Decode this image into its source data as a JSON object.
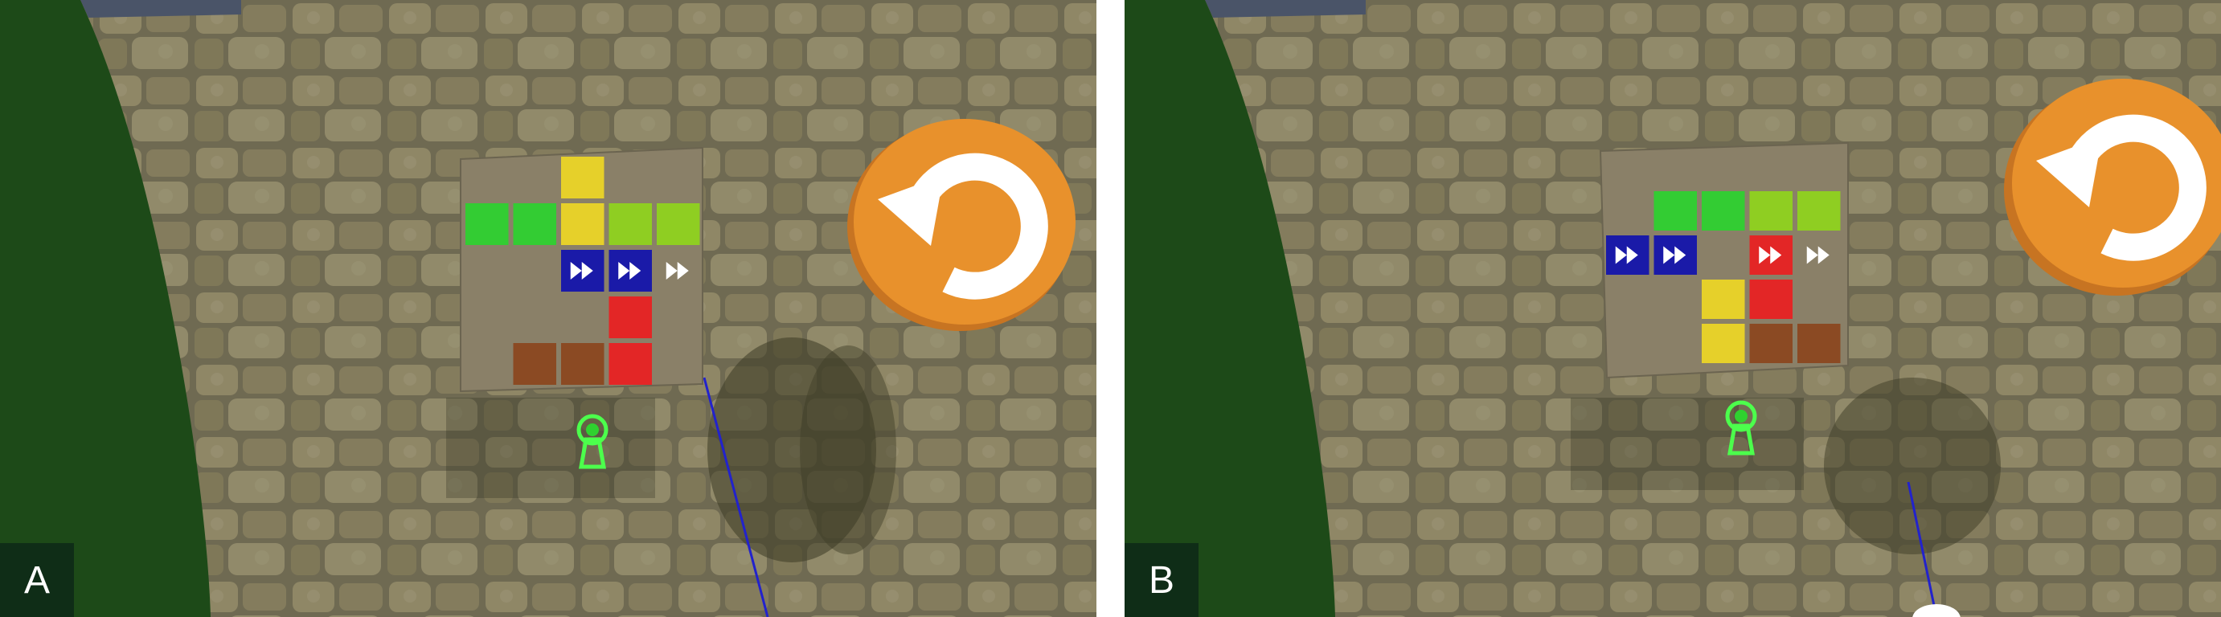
{
  "panels": [
    {
      "label": "A",
      "board": [
        [
          "empty",
          "empty",
          "yellow",
          "empty",
          "empty"
        ],
        [
          "green",
          "green",
          "yellow",
          "lime",
          "lime"
        ],
        [
          "empty",
          "empty",
          "arrow-blue",
          "arrow-blue",
          "arrow-white"
        ],
        [
          "empty",
          "empty",
          "empty",
          "red",
          "empty"
        ],
        [
          "empty",
          "brown",
          "brown",
          "red",
          "empty"
        ]
      ]
    },
    {
      "label": "B",
      "board": [
        [
          "empty",
          "empty",
          "empty",
          "empty",
          "empty"
        ],
        [
          "empty",
          "green",
          "green",
          "lime",
          "lime"
        ],
        [
          "arrow-blue",
          "arrow-blue",
          "empty",
          "arrow-red",
          "arrow-white"
        ],
        [
          "empty",
          "empty",
          "yellow",
          "red",
          "empty"
        ],
        [
          "empty",
          "empty",
          "yellow",
          "brown",
          "brown"
        ]
      ]
    }
  ],
  "colors": {
    "green": "#33cc33",
    "lime": "#8fce22",
    "yellow": "#e6d02a",
    "red": "#e32626",
    "brown": "#8b4a23",
    "blue": "#1a1aa8",
    "board": "#8a8068",
    "reset_button": "#e8912c",
    "wall_base": "#6f6a52",
    "grass": "#1d4a18"
  },
  "icons": {
    "reset": "reset-icon",
    "lock": "keyhole-lock-icon"
  }
}
